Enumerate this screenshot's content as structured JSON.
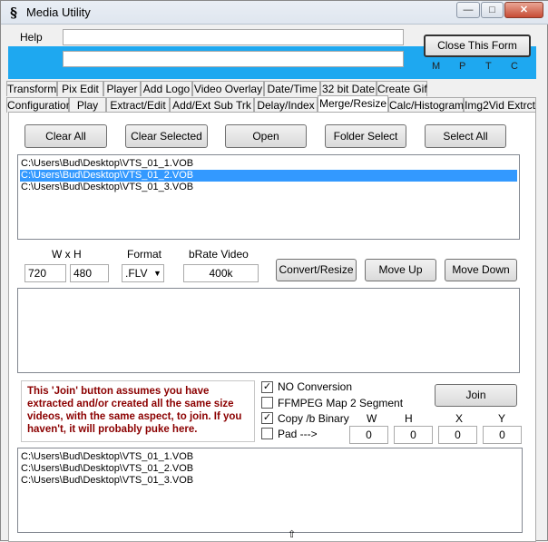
{
  "window": {
    "title": "Media Utility",
    "icon": "ampersand-app-icon",
    "min": "—",
    "max": "□",
    "close": "✕"
  },
  "menu": {
    "help": "Help"
  },
  "header": {
    "close_form": "Close This Form",
    "m": "M",
    "p": "P",
    "t": "T",
    "c": "C"
  },
  "tabs_row1": [
    "Transform",
    "Pix Edit",
    "Player",
    "Add Logo",
    "Video Overlay",
    "Date/Time",
    "32 bit Date",
    "Create Gif"
  ],
  "tabs_row2": [
    "Configuration",
    "Play",
    "Extract/Edit",
    "Add/Ext Sub Trk",
    "Delay/Index",
    "Merge/Resize",
    "Calc/Histogram",
    "Img2Vid Extrct"
  ],
  "buttons": {
    "clear_all": "Clear All",
    "clear_selected": "Clear Selected",
    "open": "Open",
    "folder_select": "Folder Select",
    "select_all": "Select All"
  },
  "file_list": [
    "C:\\Users\\Bud\\Desktop\\VTS_01_1.VOB",
    "C:\\Users\\Bud\\Desktop\\VTS_01_2.VOB",
    "C:\\Users\\Bud\\Desktop\\VTS_01_3.VOB"
  ],
  "resize": {
    "wxh_label": "W x H",
    "format_label": "Format",
    "bitrate_label": "bRate Video",
    "width": "720",
    "height": "480",
    "format": ".FLV",
    "bitrate": "400k",
    "convert": "Convert/Resize",
    "move_up": "Move Up",
    "move_down": "Move Down"
  },
  "join": {
    "warning": "This 'Join' button assumes you have extracted  and/or created all the same size videos, with the same aspect,  to join.  If you haven't, it will probably puke here.",
    "no_conversion": "NO Conversion",
    "ffmpeg_map": "FFMPEG Map 2 Segment",
    "copy_binary": "Copy /b Binary",
    "pad": "Pad  --->",
    "join_btn": "Join",
    "w_label": "W",
    "h_label": "H",
    "x_label": "X",
    "y_label": "Y",
    "w": "0",
    "h": "0",
    "x": "0",
    "y": "0"
  },
  "output_list": [
    "C:\\Users\\Bud\\Desktop\\VTS_01_1.VOB",
    "C:\\Users\\Bud\\Desktop\\VTS_01_2.VOB",
    "C:\\Users\\Bud\\Desktop\\VTS_01_3.VOB"
  ]
}
